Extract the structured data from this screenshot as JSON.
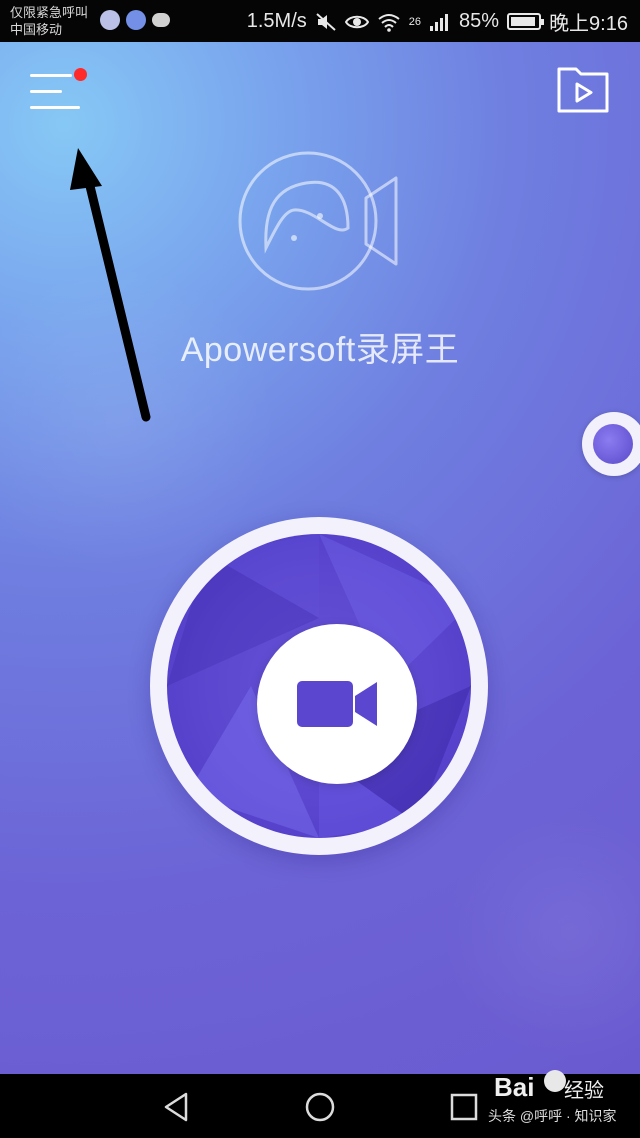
{
  "status_bar": {
    "carrier_line1": "仅限紧急呼叫",
    "carrier_line2": "中国移动",
    "network_speed": "1.5M/s",
    "signal_label": "26",
    "battery_percent": "85%",
    "battery_level": 0.85,
    "time": "晚上9:16",
    "icons": [
      "link-app-icon",
      "browser-app-icon",
      "cloud-icon",
      "mute-icon",
      "eye-icon",
      "wifi-icon",
      "signal-icon",
      "battery-icon"
    ]
  },
  "app": {
    "title": "Apowersoft录屏王",
    "menu_icon": "hamburger-menu-icon",
    "notification_color": "#ff2a2a",
    "folder_icon": "video-folder-icon",
    "record_icon": "video-camera-icon",
    "accent_color": "#5b47cf",
    "background_colors": [
      "#86c8f5",
      "#6c63d6"
    ]
  },
  "annotation": {
    "arrow_color": "#000000"
  },
  "nav_bar": {
    "icons": [
      "back-icon",
      "home-icon",
      "recent-apps-icon"
    ]
  },
  "watermark": {
    "brand_top": "Bai",
    "brand_suffix": "经验",
    "brand_bottom": "头条 @呼呼 · 知识家"
  }
}
